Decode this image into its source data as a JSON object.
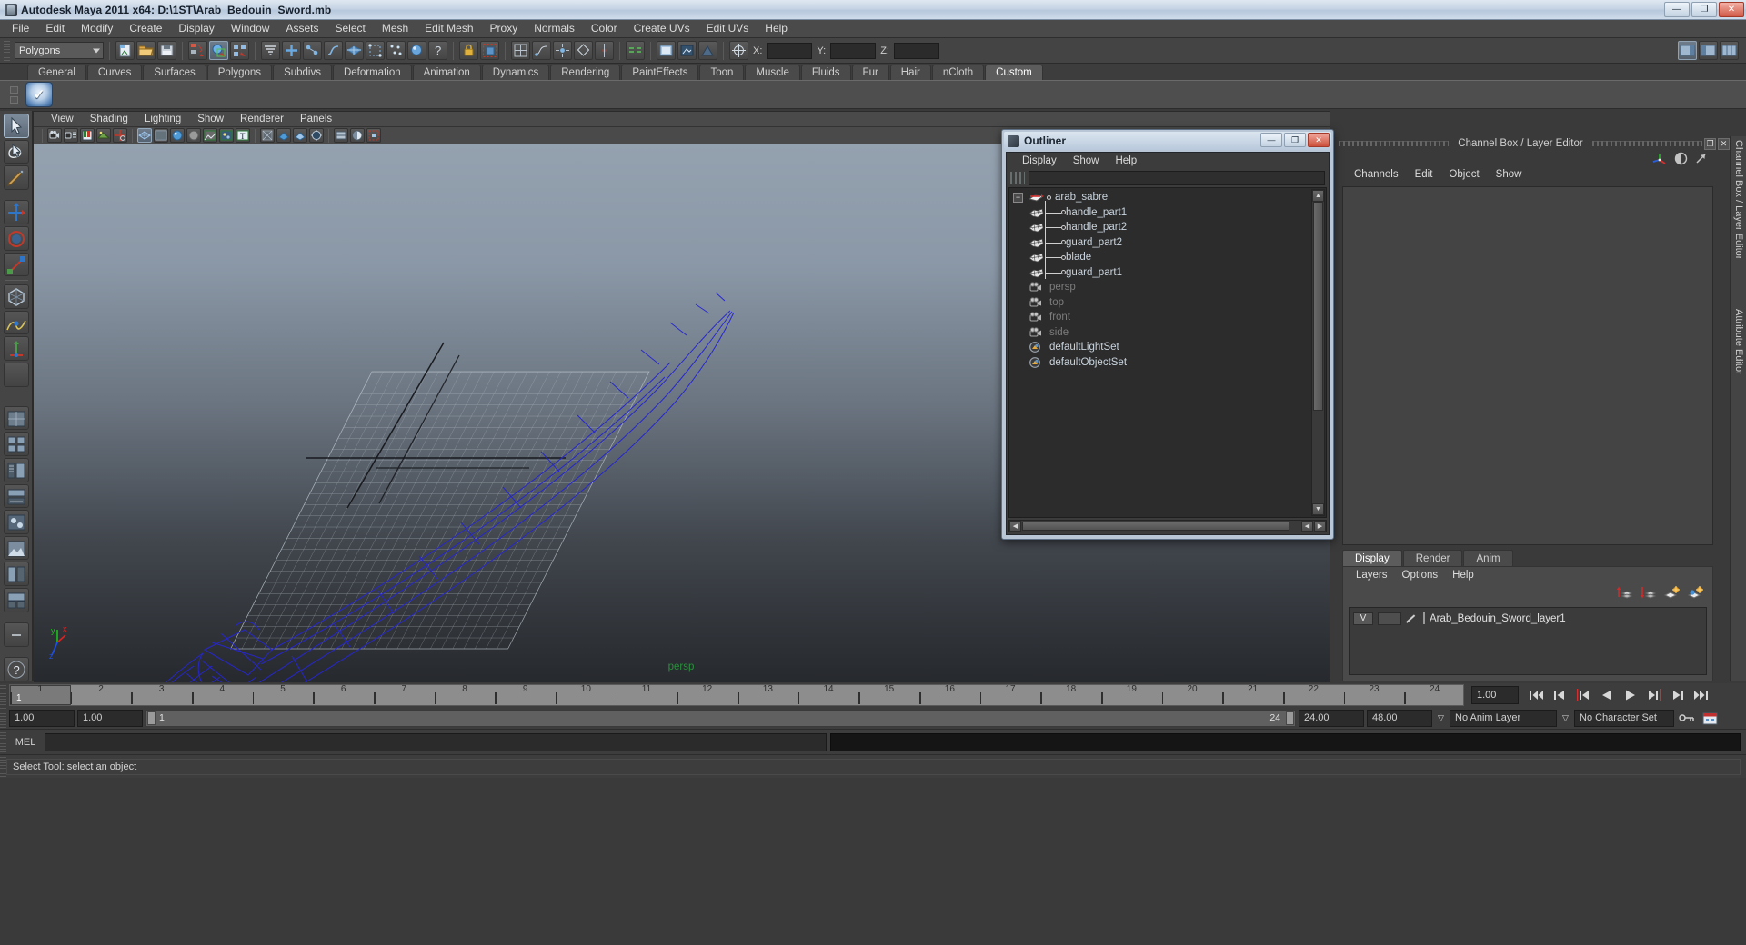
{
  "window": {
    "title": "Autodesk Maya 2011 x64: D:\\1ST\\Arab_Bedouin_Sword.mb",
    "minimize": "—",
    "maximize": "❐",
    "close": "✕"
  },
  "menubar": {
    "items": [
      "File",
      "Edit",
      "Modify",
      "Create",
      "Display",
      "Window",
      "Assets",
      "Select",
      "Mesh",
      "Edit Mesh",
      "Proxy",
      "Normals",
      "Color",
      "Create UVs",
      "Edit UVs",
      "Help"
    ]
  },
  "statusline": {
    "mode_selector": "Polygons",
    "x_label": "X:",
    "y_label": "Y:",
    "z_label": "Z:",
    "x_value": "",
    "y_value": "",
    "z_value": ""
  },
  "shelf": {
    "tabs": [
      "General",
      "Curves",
      "Surfaces",
      "Polygons",
      "Subdivs",
      "Deformation",
      "Animation",
      "Dynamics",
      "Rendering",
      "PaintEffects",
      "Toon",
      "Muscle",
      "Fluids",
      "Fur",
      "Hair",
      "nCloth",
      "Custom"
    ],
    "active_tab": "Custom"
  },
  "viewport": {
    "menus": [
      "View",
      "Shading",
      "Lighting",
      "Show",
      "Renderer",
      "Panels"
    ],
    "camera_label": "persp",
    "axis": {
      "x": "x",
      "y": "y",
      "z": "z"
    }
  },
  "outliner": {
    "title": "Outliner",
    "menus": [
      "Display",
      "Show",
      "Help"
    ],
    "search_value": "",
    "minimize": "—",
    "maximize": "❐",
    "close": "✕",
    "items": [
      {
        "label": "arab_sabre",
        "type": "transform",
        "indent": 0,
        "expanded": true,
        "dim": false
      },
      {
        "label": "handle_part1",
        "type": "mesh",
        "indent": 1,
        "expanded": false,
        "dim": false
      },
      {
        "label": "handle_part2",
        "type": "mesh",
        "indent": 1,
        "expanded": false,
        "dim": false
      },
      {
        "label": "guard_part2",
        "type": "mesh",
        "indent": 1,
        "expanded": false,
        "dim": false
      },
      {
        "label": "blade",
        "type": "mesh",
        "indent": 1,
        "expanded": false,
        "dim": false
      },
      {
        "label": "guard_part1",
        "type": "mesh",
        "indent": 1,
        "expanded": false,
        "dim": false
      },
      {
        "label": "persp",
        "type": "camera",
        "indent": 0,
        "expanded": false,
        "dim": true
      },
      {
        "label": "top",
        "type": "camera",
        "indent": 0,
        "expanded": false,
        "dim": true
      },
      {
        "label": "front",
        "type": "camera",
        "indent": 0,
        "expanded": false,
        "dim": true
      },
      {
        "label": "side",
        "type": "camera",
        "indent": 0,
        "expanded": false,
        "dim": true
      },
      {
        "label": "defaultLightSet",
        "type": "set",
        "indent": 0,
        "expanded": false,
        "dim": false
      },
      {
        "label": "defaultObjectSet",
        "type": "set",
        "indent": 0,
        "expanded": false,
        "dim": false
      }
    ]
  },
  "channelbox": {
    "panel_title": "Channel Box / Layer Editor",
    "side_labels": [
      "Channel Box / Layer Editor",
      "Attribute Editor"
    ],
    "menus": [
      "Channels",
      "Edit",
      "Object",
      "Show"
    ],
    "restore": "❐",
    "close": "✕"
  },
  "layer_editor": {
    "tabs": [
      "Display",
      "Render",
      "Anim"
    ],
    "active_tab": "Display",
    "menus": [
      "Layers",
      "Options",
      "Help"
    ],
    "rows": [
      {
        "visibility": "V",
        "name": "Arab_Bedouin_Sword_layer1"
      }
    ]
  },
  "timeslider": {
    "current_frame": "1",
    "current_frame_field": "1.00",
    "ticks": [
      "1",
      "2",
      "3",
      "4",
      "5",
      "6",
      "7",
      "8",
      "9",
      "10",
      "11",
      "12",
      "13",
      "14",
      "15",
      "16",
      "17",
      "18",
      "19",
      "20",
      "21",
      "22",
      "23",
      "24"
    ],
    "playback_buttons": [
      "go-to-start",
      "step-back-key",
      "step-back-frame",
      "play-backwards",
      "play-forwards",
      "step-forward-frame",
      "step-forward-key",
      "go-to-end"
    ]
  },
  "rangeslider": {
    "anim_start": "1.00",
    "range_start": "1.00",
    "range_start_label": "1",
    "range_end_label": "24",
    "range_end": "24.00",
    "anim_end": "48.00",
    "anim_layer": "No Anim Layer",
    "character_set": "No Character Set"
  },
  "commandline": {
    "lang_label": "MEL",
    "input_value": "",
    "output_value": ""
  },
  "helpline": {
    "message": "Select Tool: select an object"
  },
  "colors": {
    "wireframe": "#2b2bd0",
    "grid": "#9aa3ad",
    "viewport_top": "#93a0ae",
    "viewport_bottom": "#282b2f",
    "camera_label": "#2a8f3c"
  }
}
